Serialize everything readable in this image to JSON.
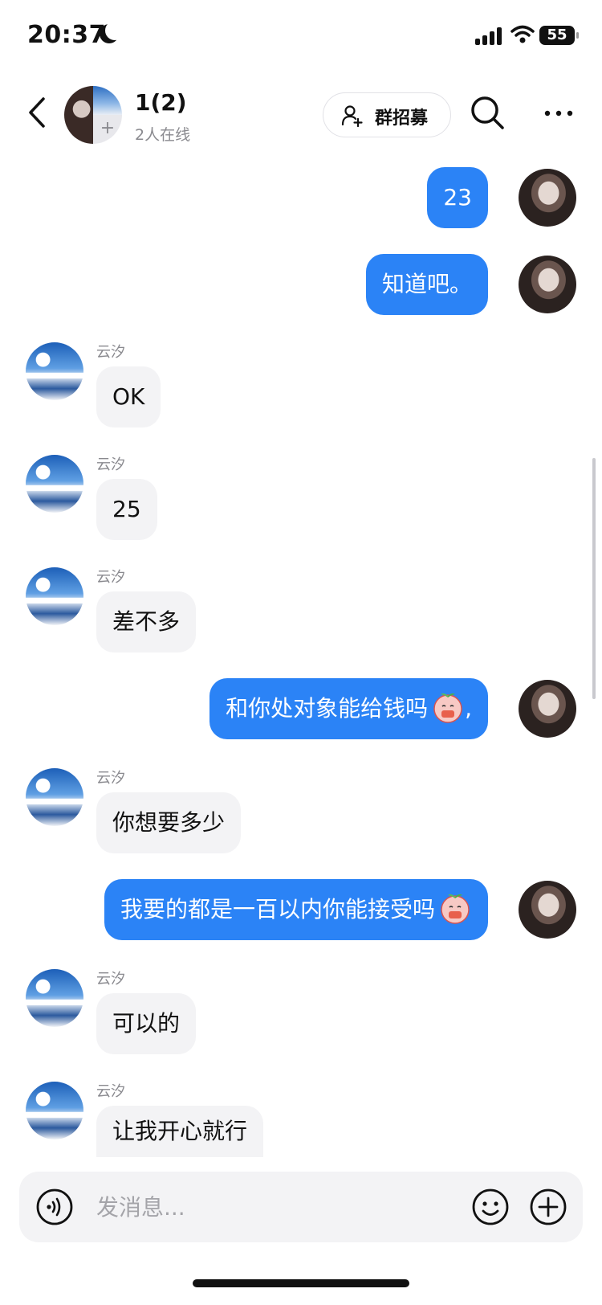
{
  "status_bar": {
    "time": "20:37",
    "battery": "55"
  },
  "header": {
    "group_title": "1(2)",
    "online_status": "2人在线",
    "avatar_add_glyph": "+",
    "recruit_label": "群招募"
  },
  "messages": [
    {
      "from": "me",
      "text": "23"
    },
    {
      "from": "me",
      "text": "知道吧。"
    },
    {
      "from": "other",
      "sender": "云汐",
      "text": "OK"
    },
    {
      "from": "other",
      "sender": "云汐",
      "text": "25"
    },
    {
      "from": "other",
      "sender": "云汐",
      "text": "差不多"
    },
    {
      "from": "me",
      "text": "和你处对象能给钱吗",
      "suffix": ",",
      "emoji": "peach-face-emoji"
    },
    {
      "from": "other",
      "sender": "云汐",
      "text": "你想要多少"
    },
    {
      "from": "me",
      "text": "我要的都是一百以内你能接受吗",
      "emoji": "peach-face-emoji"
    },
    {
      "from": "other",
      "sender": "云汐",
      "text": "可以的"
    },
    {
      "from": "other",
      "sender": "云汐",
      "text": "让我开心就行"
    }
  ],
  "input": {
    "placeholder": "发消息..."
  },
  "colors": {
    "accent": "#2b83f6",
    "other_bubble": "#f3f3f5"
  },
  "icons": [
    "back-arrow-icon",
    "add-member-icon",
    "search-icon",
    "more-icon",
    "voice-icon",
    "emoji-icon",
    "plus-icon"
  ]
}
